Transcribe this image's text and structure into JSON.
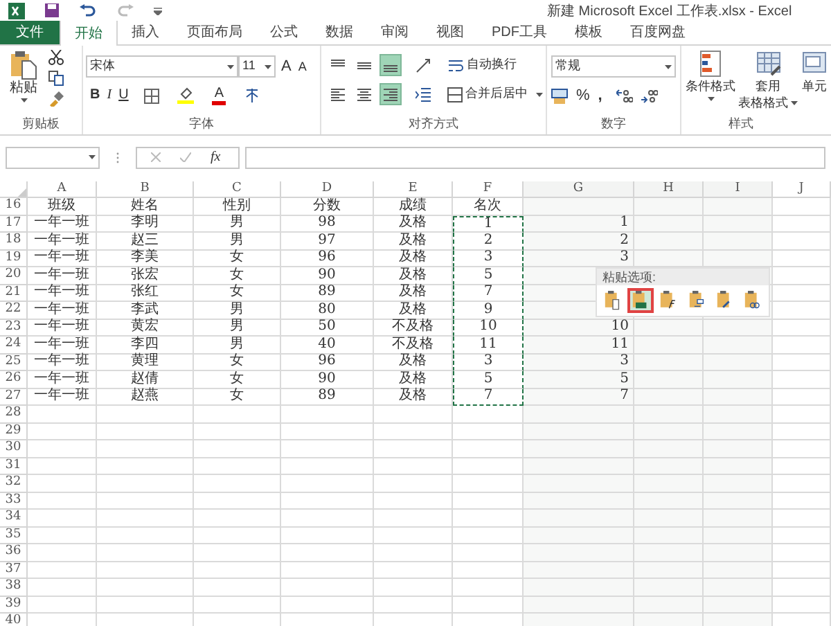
{
  "title_bar": {
    "title": "新建 Microsoft Excel 工作表.xlsx - Excel"
  },
  "tabs": [
    {
      "label": "文件",
      "kind": "file",
      "selected": false
    },
    {
      "label": "开始",
      "kind": "tab",
      "selected": true
    },
    {
      "label": "插入",
      "kind": "tab",
      "selected": false
    },
    {
      "label": "页面布局",
      "kind": "tab",
      "selected": false
    },
    {
      "label": "公式",
      "kind": "tab",
      "selected": false
    },
    {
      "label": "数据",
      "kind": "tab",
      "selected": false
    },
    {
      "label": "审阅",
      "kind": "tab",
      "selected": false
    },
    {
      "label": "视图",
      "kind": "tab",
      "selected": false
    },
    {
      "label": "PDF工具",
      "kind": "tab",
      "selected": false
    },
    {
      "label": "模板",
      "kind": "tab",
      "selected": false
    },
    {
      "label": "百度网盘",
      "kind": "tab",
      "selected": false
    }
  ],
  "ribbon": {
    "clipboard": {
      "label": "剪贴板",
      "paste": "粘贴"
    },
    "font": {
      "label": "字体",
      "font_name": "宋体",
      "font_size": "11",
      "grow_font": "A",
      "shrink_font": "A",
      "bold": "B",
      "italic": "I",
      "underline": "U",
      "font_color": "A"
    },
    "alignment": {
      "label": "对齐方式",
      "vertical_align": [
        {
          "selected": false
        },
        {
          "selected": false
        },
        {
          "selected": true
        }
      ],
      "horizontal_align": [
        {
          "selected": false
        },
        {
          "selected": false
        },
        {
          "selected": true
        }
      ],
      "wrap_text": "自动换行",
      "merge_center": "合并后居中"
    },
    "number": {
      "label": "数字",
      "format": "常规",
      "percent": "%",
      "comma": ","
    },
    "styles": {
      "label": "样式",
      "conditional_format": "条件格式",
      "table_format": [
        "套用",
        "表格格式"
      ],
      "cell_styles": "单元"
    }
  },
  "formula_bar": {
    "fx": "fx"
  },
  "sheet": {
    "columns": [
      "A",
      "B",
      "C",
      "D",
      "E",
      "F",
      "G",
      "H",
      "I",
      "J"
    ],
    "rows": [
      {
        "number": "16",
        "cells": [
          "班级",
          "姓名",
          "性别",
          "分数",
          "成绩",
          "名次"
        ],
        "copied": false
      },
      {
        "number": "17",
        "cells": [
          "一年一班",
          "李明",
          "男",
          "98",
          "及格",
          "1"
        ],
        "column_g": "1",
        "copied": true
      },
      {
        "number": "18",
        "cells": [
          "一年一班",
          "赵三",
          "男",
          "97",
          "及格",
          "2"
        ],
        "column_g": "2",
        "copied": true
      },
      {
        "number": "19",
        "cells": [
          "一年一班",
          "李美",
          "女",
          "96",
          "及格",
          "3"
        ],
        "column_g": "3",
        "copied": true
      },
      {
        "number": "20",
        "cells": [
          "一年一班",
          "张宏",
          "女",
          "90",
          "及格",
          "5"
        ],
        "copied": true
      },
      {
        "number": "21",
        "cells": [
          "一年一班",
          "张红",
          "女",
          "89",
          "及格",
          "7"
        ],
        "copied": true
      },
      {
        "number": "22",
        "cells": [
          "一年一班",
          "李武",
          "男",
          "80",
          "及格",
          "9"
        ],
        "copied": true
      },
      {
        "number": "23",
        "cells": [
          "一年一班",
          "黄宏",
          "男",
          "50",
          "不及格",
          "10"
        ],
        "column_g": "10",
        "copied": true
      },
      {
        "number": "24",
        "cells": [
          "一年一班",
          "李四",
          "男",
          "40",
          "不及格",
          "11"
        ],
        "column_g": "11",
        "copied": true
      },
      {
        "number": "25",
        "cells": [
          "一年一班",
          "黄理",
          "女",
          "96",
          "及格",
          "3"
        ],
        "column_g": "3",
        "copied": true
      },
      {
        "number": "26",
        "cells": [
          "一年一班",
          "赵倩",
          "女",
          "90",
          "及格",
          "5"
        ],
        "column_g": "5",
        "copied": true
      },
      {
        "number": "27",
        "cells": [
          "一年一班",
          "赵燕",
          "女",
          "89",
          "及格",
          "7"
        ],
        "column_g": "7",
        "copied": true
      },
      {
        "number": "28"
      },
      {
        "number": "29"
      },
      {
        "number": "30"
      },
      {
        "number": "31"
      },
      {
        "number": "32"
      },
      {
        "number": "33"
      },
      {
        "number": "34"
      },
      {
        "number": "35"
      },
      {
        "number": "36"
      },
      {
        "number": "37"
      },
      {
        "number": "38"
      },
      {
        "number": "39"
      },
      {
        "number": "40"
      }
    ]
  },
  "paste_options": {
    "title": "粘贴选项:",
    "options": [
      {
        "kind": "paste",
        "selected": false
      },
      {
        "kind": "values",
        "selected": true
      },
      {
        "kind": "formulas",
        "selected": false
      },
      {
        "kind": "transpose",
        "selected": false
      },
      {
        "kind": "formatting",
        "selected": false
      },
      {
        "kind": "link",
        "selected": false
      }
    ]
  }
}
